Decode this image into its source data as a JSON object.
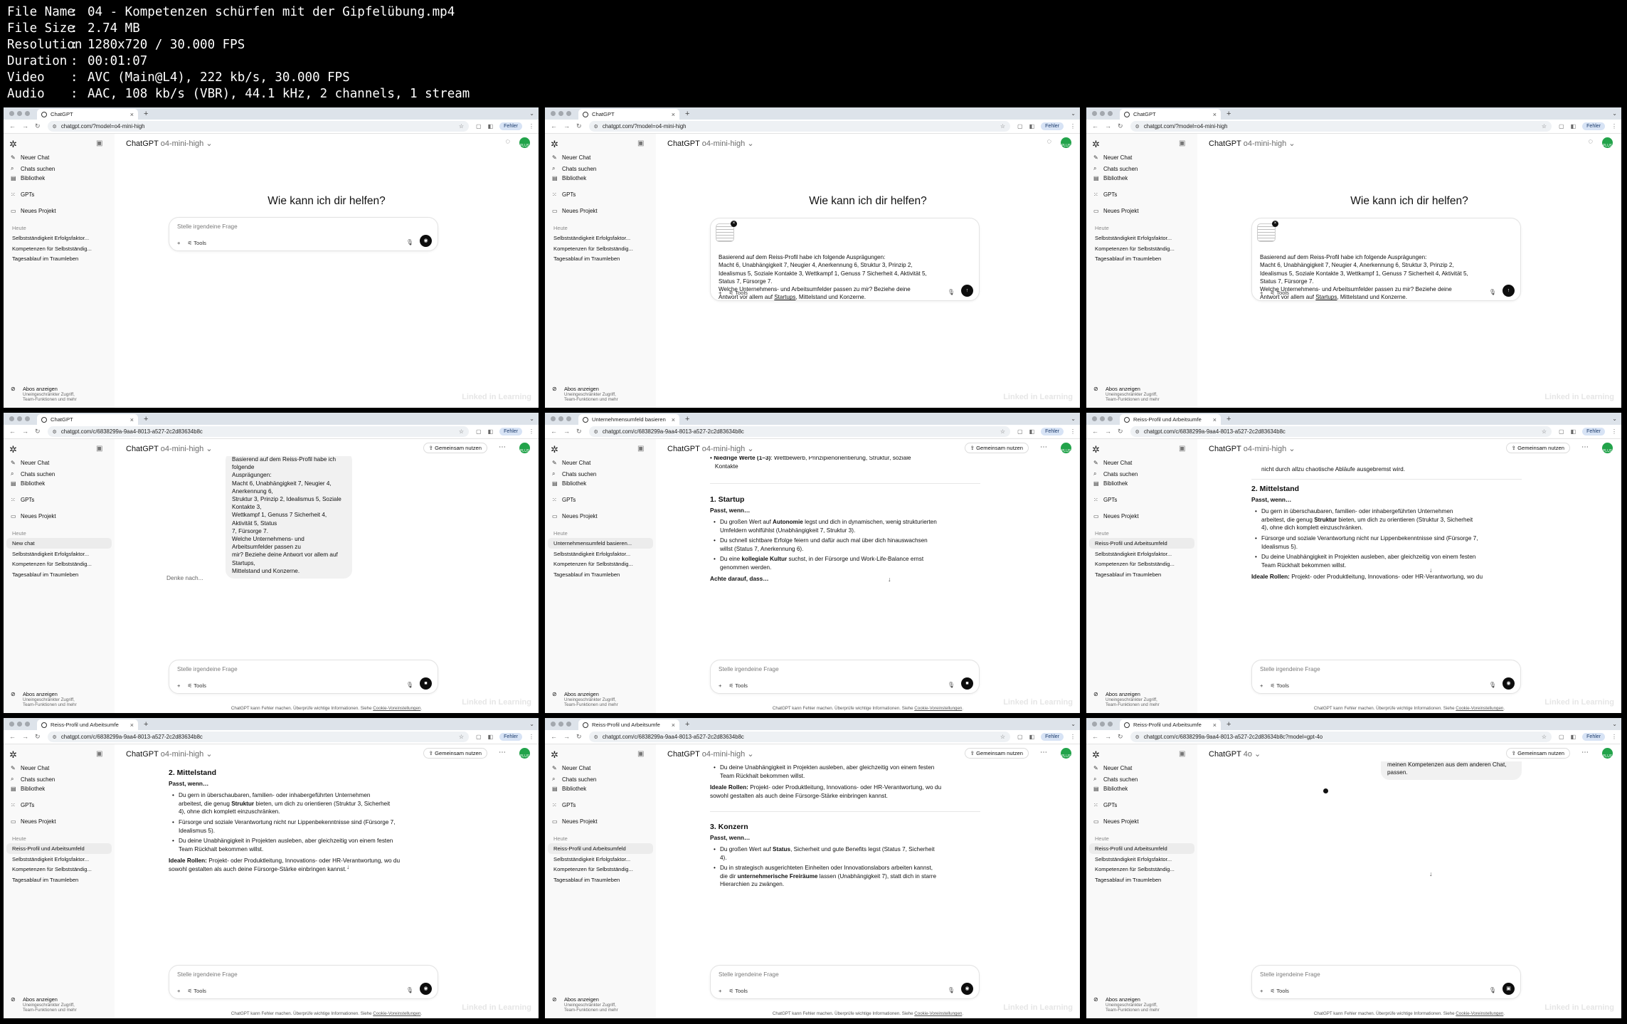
{
  "meta": {
    "rows": [
      {
        "key": "File Name",
        "value": "04 - Kompetenzen schürfen mit der Gipfelübung.mp4"
      },
      {
        "key": "File Size",
        "value": "2.74 MB"
      },
      {
        "key": "Resolution",
        "value": "1280x720 / 30.000 FPS"
      },
      {
        "key": "Duration",
        "value": "00:01:07"
      },
      {
        "key": "Video",
        "value": "AVC (Main@L4), 222 kb/s, 30.000 FPS"
      },
      {
        "key": "Audio",
        "value": "AAC, 108 kb/s (VBR), 44.1 kHz, 2 channels, 1 stream"
      }
    ],
    "separator": ":"
  },
  "common": {
    "tab_close": "×",
    "new_tab": "+",
    "fehler": "Fehler",
    "sidebar": {
      "neuer_chat": "Neuer Chat",
      "chats_suchen": "Chats suchen",
      "bibliothek": "Bibliothek",
      "gpts": "GPTs",
      "neues_projekt": "Neues Projekt",
      "heute": "Heute",
      "abos_title": "Abos anzeigen",
      "abos_sub1": "Uneingeschränkter Zugriff,",
      "abos_sub2": "Team-Funktionen und mehr"
    },
    "share": "Gemeinsam nutzen",
    "placeholder": "Stelle irgendeine Frage",
    "tools": "Tools",
    "welcome": "Wie kann ich dir helfen?",
    "footer_prefix": "ChatGPT kann Fehler machen. Überprüfe wichtige Informationen. Siehe ",
    "footer_link": "Cookie-Voreinstellungen",
    "footer_suffix": ".",
    "watermark": "Linked in Learning",
    "model_name": "ChatGPT",
    "model_version": "o4-mini-high",
    "model_version_4o": "4o",
    "thinking": "Denke nach...",
    "avatar": "PLUS"
  },
  "chats": {
    "c1": "Selbstständigkeit Erfolgsfaktor...",
    "c2": "Kompetenzen für Selbstständig...",
    "c3": "Tagesablauf im Traumleben",
    "new_chat": "New chat",
    "unternehmensumfeld": "Unternehmensumfeld basieren...",
    "reiss": "Reiss-Profil und Arbeitsumfeld"
  },
  "tabs": {
    "chatgpt": "ChatGPT",
    "unternehmensumfeld": "Unternehmensumfeld basieren",
    "reiss": "Reiss-Profil und Arbeitsumfe"
  },
  "urls": {
    "model": "chatgpt.com/?model=o4-mini-high",
    "conversation": "chatgpt.com/c/6838299a-9aa4-8013-a527-2c2d83634b8c",
    "conversation_4o": "chatgpt.com/c/6838299a-9aa4-8013-a527-2c2d83634b8c?model=gpt-4o"
  },
  "prompt": {
    "line1": "Basierend auf dem Reiss-Profil habe ich folgende Ausprägungen:",
    "line2": "Macht 6, Unabhängigkeit 7, Neugier 4, Anerkennung 6, Struktur 3, Prinzip 2,",
    "line3": "Idealismus 5, Soziale Kontakte 3, Wettkampf 1, Genuss 7 Sicherheit 4, Aktivität 5,",
    "line4": "Status 7, Fürsorge 7.",
    "line5": "Welche Unternehmens- und Arbeitsumfelder passen zu mir? Beziehe deine",
    "line6a": "Antwort vor allem auf ",
    "line6b": "Startups",
    "line6c": ", Mittelstand und Konzerne."
  },
  "bubble": {
    "l1": "Basierend auf dem Reiss-Profil habe ich folgende",
    "l2": "Ausprägungen:",
    "l3": "Macht 6, Unabhängigkeit 7, Neugier 4, Anerkennung 6,",
    "l4": "Struktur 3, Prinzip 2, Idealismus 5, Soziale Kontakte 3,",
    "l5": "Wettkampf 1, Genuss 7 Sicherheit 4, Aktivität 5, Status",
    "l6": "7, Fürsorge 7.",
    "l7": "Welche Unternehmens- und Arbeitsumfelder passen zu",
    "l8": "mir? Beziehe deine Antwort vor allem auf Startups,",
    "l9": "Mittelstand und Konzerne."
  },
  "response": {
    "niedrige_label": "Niedrige Werte (1–3)",
    "niedrige_rest": ": Wettbewerb, Prinzipienorientierung, Struktur, soziale",
    "niedrige_l2": "Kontakte",
    "startup_h": "1. Startup",
    "passt": "Passt, wenn…",
    "s1a": "Du großen Wert auf ",
    "s1b": "Autonomie",
    "s1c": " legst und dich in dynamischen, wenig strukturierten",
    "s1d": "Umfeldern wohlfühlst (Unabhängigkeit 7, Struktur 3).",
    "s2a": "Du schnell sichtbare Erfolge feiern und dafür auch mal über dich hinauswachsen",
    "s2b": "willst (Status 7, Anerkennung 6).",
    "s3a": "Du eine ",
    "s3b": "kollegiale Kultur",
    "s3c": " suchst, in der Fürsorge und Work-Life-Balance ernst",
    "s3d": "genommen werden.",
    "achte": "Achte darauf, dass…",
    "chaos": "nicht durch allzu chaotische Abläufe ausgebremst wird.",
    "mittel_h": "2. Mittelstand",
    "m1a": "Du gern in überschaubaren, familien- oder inhabergeführten Unternehmen",
    "m1b": "arbeitest, die genug ",
    "m1c": "Struktur",
    "m1d": " bieten, um dich zu orientieren (Struktur 3, Sicherheit",
    "m1e": "4), ohne dich komplett einzuschränken.",
    "m2a": "Fürsorge und soziale Verantwortung nicht nur Lippenbekenntnisse sind (Fürsorge 7,",
    "m2b": "Idealismus 5).",
    "m3a": "Du deine Unabhängigkeit in Projekten ausleben, aber gleichzeitig von einem festen",
    "m3b": "Team Rückhalt bekommen willst.",
    "ideal_label": "Ideale Rollen:",
    "ideal_rest": " Projekt- oder Produktleitung, Innovations- oder HR-Verantwortung, wo du",
    "ideal_l2": "sowohl gestalten als auch deine Fürsorge-Stärke einbringen kannst.",
    "konzern_h": "3. Konzern",
    "k1a": "Du großen Wert auf ",
    "k1b": "Status",
    "k1c": ", Sicherheit und gute Benefits legst (Status 7, Sicherheit",
    "k1d": "4).",
    "k2a": "Du in strategisch ausgerichteten Einheiten oder Innovationslabors arbeiten kannst,",
    "k2b": "die dir ",
    "k2c": "unternehmerische Freiräume",
    "k2d": " lassen (Unabhängigkeit 7), statt dich in starre",
    "k2e": "Hierarchien zu zwängen.",
    "prev_4o": "meinen Kompetenzen aus dem anderen Chat, passen."
  },
  "icons": {
    "logo": "openai-logo-icon",
    "sidebar": "sidebar-toggle-icon",
    "new_chat": "pencil-icon",
    "search": "search-icon",
    "library": "library-icon",
    "gpts": "grid-icon",
    "project": "folder-icon",
    "mic": "mic-icon",
    "send": "send-icon",
    "stop": "stop-icon",
    "voice": "voice-icon",
    "scroll": "arrow-down-icon"
  }
}
